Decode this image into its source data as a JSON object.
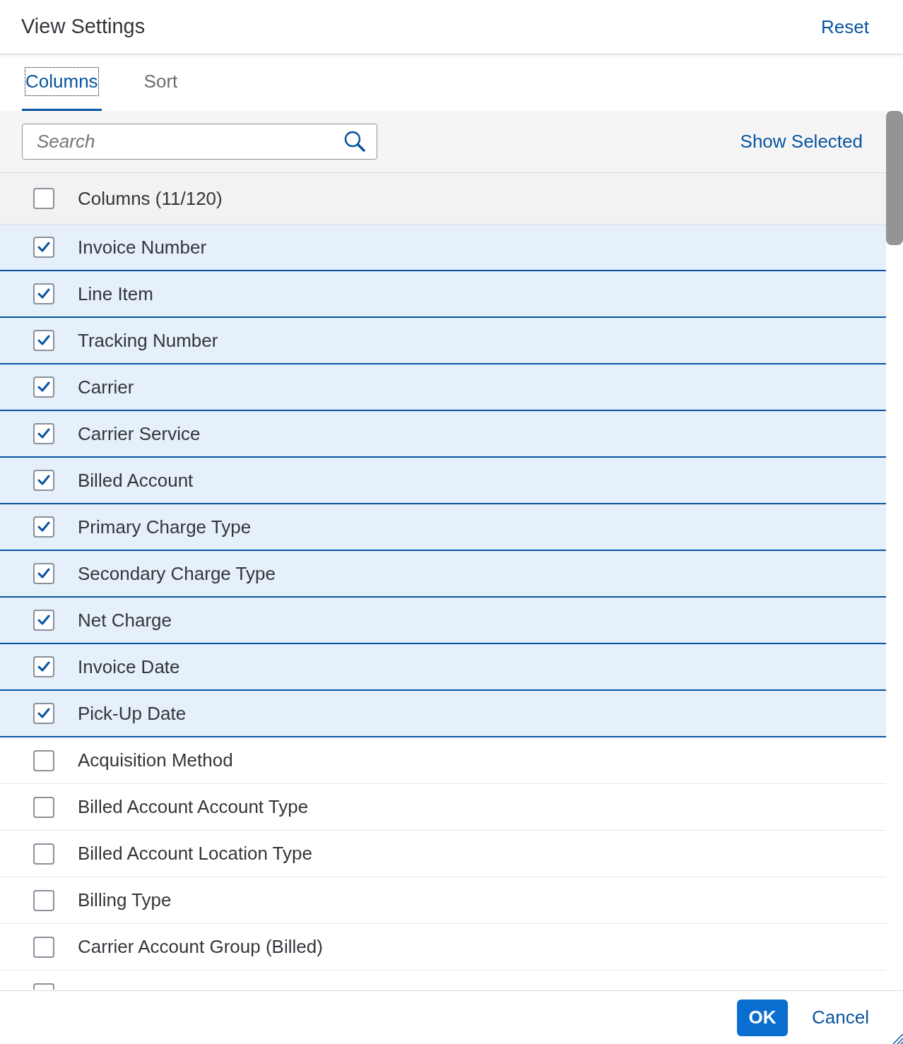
{
  "dialog": {
    "title": "View Settings",
    "reset": "Reset"
  },
  "tabs": [
    {
      "label": "Columns",
      "selected": true,
      "focused": true
    },
    {
      "label": "Sort",
      "selected": false,
      "focused": false
    }
  ],
  "toolbar": {
    "search": {
      "placeholder": "Search"
    },
    "show_selected": "Show Selected"
  },
  "list": {
    "header": {
      "label": "Columns (11/120)",
      "checked": false
    },
    "items": [
      {
        "label": "Invoice Number",
        "checked": true
      },
      {
        "label": "Line Item",
        "checked": true
      },
      {
        "label": "Tracking Number",
        "checked": true
      },
      {
        "label": "Carrier",
        "checked": true
      },
      {
        "label": "Carrier Service",
        "checked": true
      },
      {
        "label": "Billed Account",
        "checked": true
      },
      {
        "label": "Primary Charge Type",
        "checked": true
      },
      {
        "label": "Secondary Charge Type",
        "checked": true
      },
      {
        "label": "Net Charge",
        "checked": true
      },
      {
        "label": "Invoice Date",
        "checked": true
      },
      {
        "label": "Pick-Up Date",
        "checked": true
      },
      {
        "label": "Acquisition Method",
        "checked": false
      },
      {
        "label": "Billed Account Account Type",
        "checked": false
      },
      {
        "label": "Billed Account Location Type",
        "checked": false
      },
      {
        "label": "Billing Type",
        "checked": false
      },
      {
        "label": "Carrier Account Group (Billed)",
        "checked": false
      }
    ],
    "partial_item": {
      "checked": false
    }
  },
  "footer": {
    "buttons": [
      {
        "label": "OK",
        "kind": "primary"
      },
      {
        "label": "Cancel",
        "kind": "secondary"
      }
    ]
  }
}
